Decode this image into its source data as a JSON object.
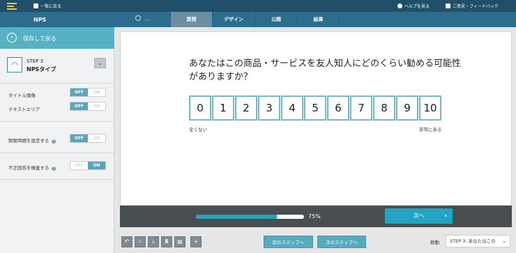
{
  "topbar": {
    "back_to_list": "一覧に戻る",
    "help": "ヘルプを見る",
    "feedback": "ご意見・フィードバック"
  },
  "header": {
    "app_title": "NPS",
    "status": "...",
    "tabs": [
      "質問",
      "デザイン",
      "公開",
      "結果"
    ],
    "active_tab": "質問"
  },
  "sidebar": {
    "back_label": "保存して戻る",
    "step_num": "STEP 3",
    "step_type": "NPSタイプ",
    "options": [
      {
        "label": "タイトル画像",
        "value": "OFF",
        "help": false
      },
      {
        "label": "テキストエリア",
        "value": "OFF",
        "help": false
      },
      {
        "label": "制限時間を設定する",
        "value": "OFF",
        "help": true
      },
      {
        "label": "不正回答を検査する",
        "value": "ON",
        "help": true
      }
    ],
    "toggle_on": "ON",
    "toggle_off": "OFF"
  },
  "question": {
    "text": "あなたはこの商品・サービスを友人知人にどのくらい勧める可能性がありますか？",
    "scale": [
      "0",
      "1",
      "2",
      "3",
      "4",
      "5",
      "6",
      "7",
      "8",
      "9",
      "10"
    ],
    "low_label": "全くない",
    "high_label": "非常にある"
  },
  "footer": {
    "progress": 0.75,
    "progress_label": "75%",
    "next_label": "次へ"
  },
  "bottom": {
    "tools": [
      "undo-icon",
      "branch-icon",
      "download-icon",
      "trophy-icon",
      "certificate-icon",
      "plus-icon"
    ],
    "prev_step": "前のステップへ",
    "next_step": "次のステップへ",
    "move_label": "移動",
    "move_value": "STEP 3: あなたはこの"
  },
  "colors": {
    "topbar": "#1f4f69",
    "tabbar": "#2c6d8f",
    "accent": "#22a4c2",
    "scale_border": "#77b9c9",
    "sidebar_back": "#57b1c5"
  }
}
